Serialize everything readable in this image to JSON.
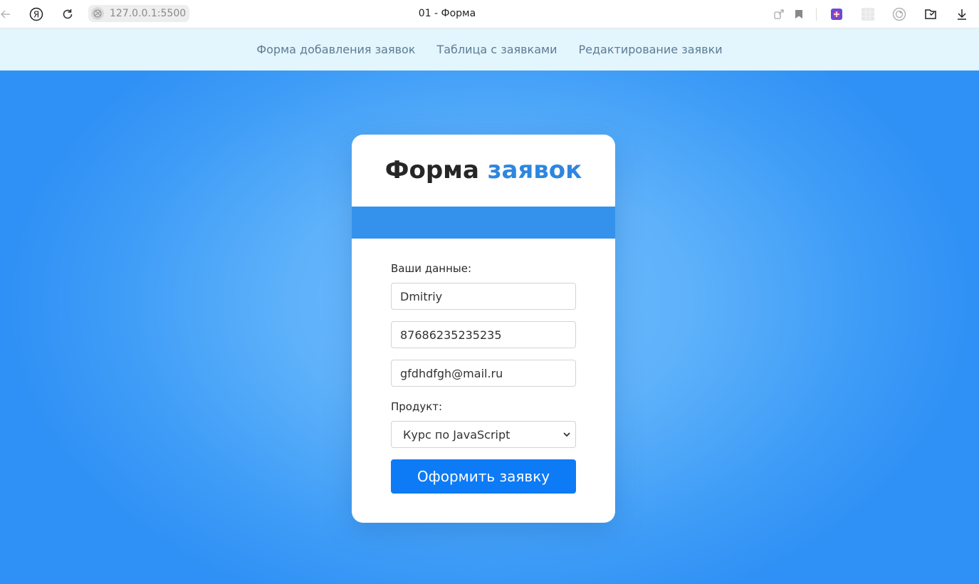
{
  "browser": {
    "url": "127.0.0.1:5500",
    "tab_title": "01 - Форма"
  },
  "nav": {
    "links": [
      "Форма добавления заявок",
      "Таблица с заявками",
      "Редактирование заявки"
    ]
  },
  "form": {
    "title_main": "Форма",
    "title_accent": "заявок",
    "your_data_label": "Ваши данные:",
    "name_value": "Dmitriy",
    "phone_value": "87686235235235",
    "email_value": "gfdhdfgh@mail.ru",
    "product_label": "Продукт:",
    "product_selected": "Курс по JavaScript",
    "submit_label": "Оформить заявку"
  },
  "colors": {
    "nav_bg": "#e3f5fd",
    "accent": "#2e86e0",
    "band": "#3592ec",
    "button": "#0d7bf6"
  }
}
